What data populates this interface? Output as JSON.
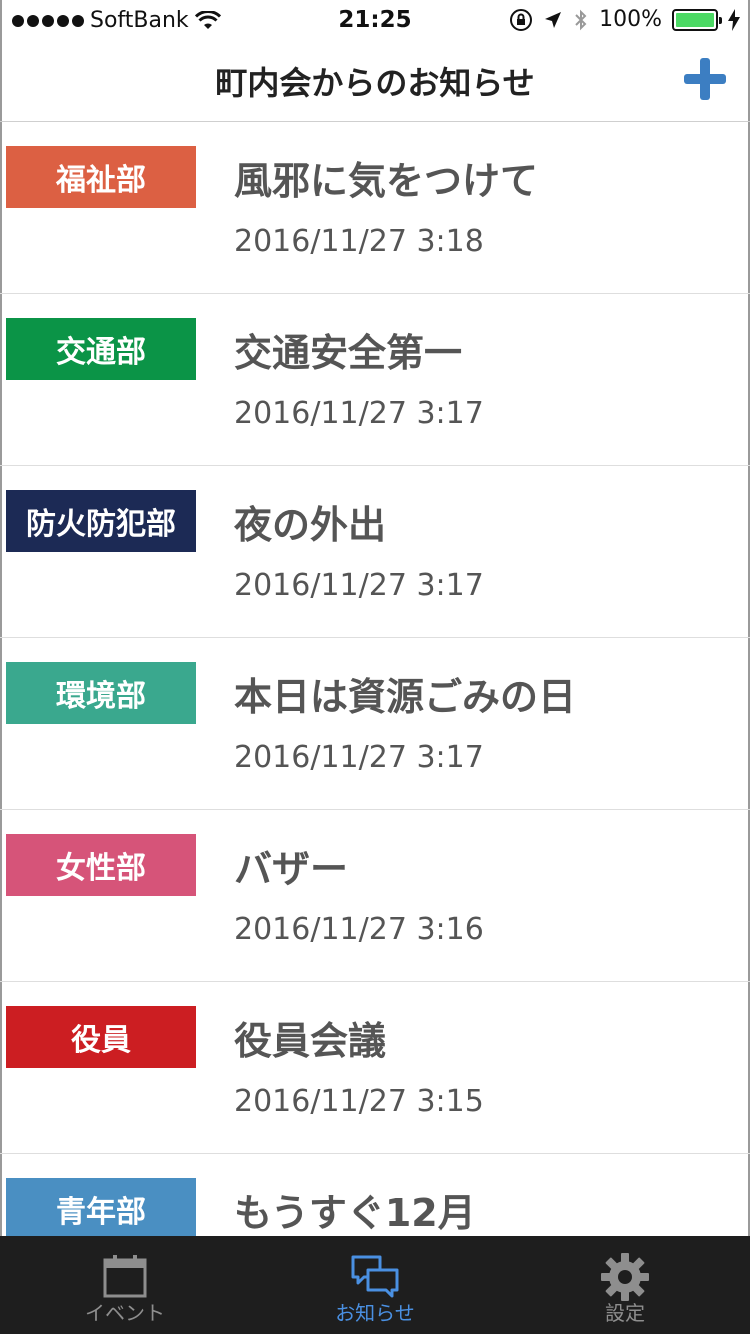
{
  "statusbar": {
    "carrier": "SoftBank",
    "time": "21:25",
    "battery": "100%"
  },
  "navbar": {
    "title": "町内会からのお知らせ"
  },
  "items": [
    {
      "category": "福祉部",
      "color": "#dc6043",
      "title": "風邪に気をつけて",
      "date": "2016/11/27 3:18"
    },
    {
      "category": "交通部",
      "color": "#0b9447",
      "title": "交通安全第一",
      "date": "2016/11/27 3:17"
    },
    {
      "category": "防火防犯部",
      "color": "#1c2a55",
      "title": "夜の外出",
      "date": "2016/11/27 3:17"
    },
    {
      "category": "環境部",
      "color": "#3aa88e",
      "title": "本日は資源ごみの日",
      "date": "2016/11/27 3:17"
    },
    {
      "category": "女性部",
      "color": "#d65479",
      "title": "バザー",
      "date": "2016/11/27 3:16"
    },
    {
      "category": "役員",
      "color": "#cc1e22",
      "title": "役員会議",
      "date": "2016/11/27 3:15"
    },
    {
      "category": "青年部",
      "color": "#4a8fc2",
      "title": "もうすぐ12月",
      "date": ""
    }
  ],
  "tabbar": {
    "tabs": [
      {
        "label": "イベント",
        "icon": "calendar-icon",
        "active": false
      },
      {
        "label": "お知らせ",
        "icon": "chat-bubbles-icon",
        "active": true
      },
      {
        "label": "設定",
        "icon": "gear-icon",
        "active": false
      }
    ]
  }
}
